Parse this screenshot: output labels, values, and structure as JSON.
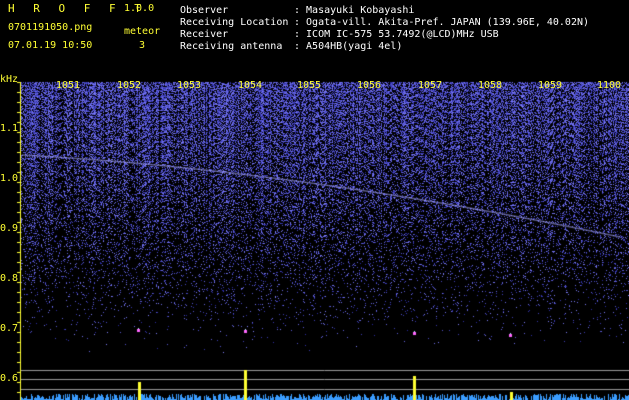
{
  "app": {
    "title": "H R O F F T",
    "version": "1.0.0",
    "filename": "0701191050.png",
    "datetime": "07.01.19 10:50",
    "meteor_label": "meteor",
    "meteor_count": "3"
  },
  "info": {
    "labels": [
      "Observer",
      "Receiving Location",
      "Receiver",
      "Receiving antenna"
    ],
    "values": [
      ": Masayuki Kobayashi",
      ": Ogata-vill. Akita-Pref. JAPAN (139.96E, 40.02N)",
      ": ICOM IC-575 53.7492(@LCD)MHz USB",
      ": A504HB(yagi 4el)"
    ]
  },
  "spectrogram": {
    "unit_label": "kHz",
    "y_ticks": [
      "1.1",
      "1.0",
      "0.9",
      "0.8",
      "0.7",
      "0.6"
    ],
    "x_ticks": [
      "1051",
      "1052",
      "1053",
      "1054",
      "1055",
      "1056",
      "1057",
      "1058",
      "1059",
      "1100"
    ],
    "colors": {
      "noise": "#2a2ad8",
      "highlight": "#ffff33",
      "signal": "#8080ff"
    }
  }
}
